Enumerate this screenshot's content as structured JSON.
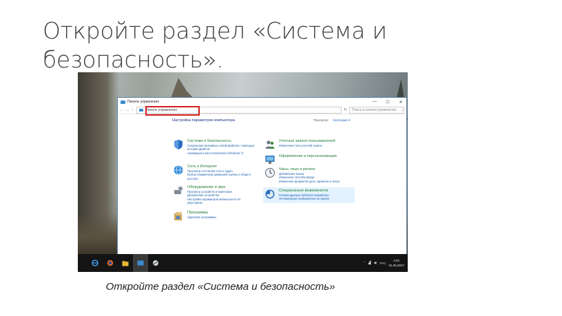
{
  "slide": {
    "title": "Откройте раздел «Система и безопасность».",
    "caption": "Откройте раздел «Система и безопасность»"
  },
  "window": {
    "title": "Панель управления",
    "controls": [
      "—",
      "☐",
      "✕"
    ],
    "address": "Панель управления",
    "search_placeholder": "Поиск в панели управления",
    "heading": "Настройка параметров компьютера",
    "view_by_label": "Просмотр:",
    "view_by_value": "Категория ▾"
  },
  "categories_left": [
    {
      "icon": "shield-icon",
      "title": "Система и безопасность",
      "links": [
        "Сохранение резервных копий файлов с помощью",
        "истории файлов",
        "Архивация и восстановление (Windows 7)"
      ]
    },
    {
      "icon": "network-icon",
      "title": "Сеть и Интернет",
      "links": [
        "Просмотр состояния сети и задач",
        "Выбор параметров домашней группы и общего",
        "доступа"
      ]
    },
    {
      "icon": "hardware-sound-icon",
      "title": "Оборудование и звук",
      "links": [
        "Просмотр устройств и принтеров",
        "Добавление устройства",
        "Настройка параметров мобильности по",
        "умолчанию"
      ]
    },
    {
      "icon": "programs-icon",
      "title": "Программы",
      "links": [
        "Удаление программы"
      ]
    }
  ],
  "categories_right": [
    {
      "icon": "user-accounts-icon",
      "title": "Учетные записи пользователей",
      "links": [
        "Изменение типа учетной записи"
      ]
    },
    {
      "icon": "appearance-icon",
      "title": "Оформление и персонализация",
      "links": []
    },
    {
      "icon": "clock-language-icon",
      "title": "Часы, язык и регион",
      "links": [
        "Добавление языка",
        "Изменение способа ввода",
        "Изменение форматов даты, времени и чисел"
      ]
    },
    {
      "icon": "ease-of-access-icon",
      "title": "Специальные возможности",
      "links": [
        "Рекомендуемые Windows параметры",
        "Оптимизация изображения на экране"
      ]
    }
  ],
  "taskbar": {
    "lang": "РУС",
    "time": "4:01",
    "date": "01.05.2017"
  },
  "colors": {
    "category_title": "#1e7b32",
    "link": "#1c5fb0",
    "heading": "#1e3287",
    "highlight_border": "#d21c1c",
    "taskbar": "#141414"
  }
}
